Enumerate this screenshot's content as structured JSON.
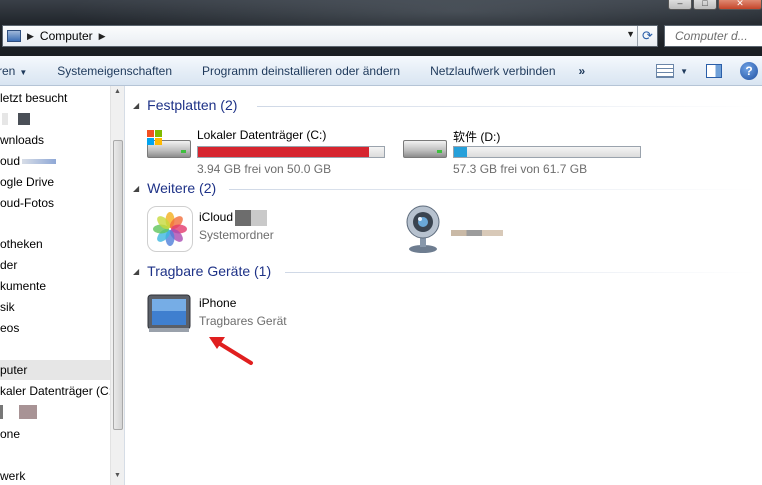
{
  "window": {
    "address_segment": "Computer",
    "search_placeholder": "Computer d...",
    "controls": [
      "minimize-icon",
      "maximize-icon",
      "close-icon"
    ]
  },
  "toolbar": {
    "organize_label": "ren",
    "items": [
      "Systemeigenschaften",
      "Programm deinstallieren oder ändern",
      "Netzlaufwerk verbinden"
    ],
    "more": "»"
  },
  "nav": {
    "items": [
      {
        "label": "letzt besucht"
      },
      {
        "label": ""
      },
      {
        "label": "wnloads"
      },
      {
        "label": "oud"
      },
      {
        "label": "ogle Drive"
      },
      {
        "label": "oud-Fotos"
      },
      {
        "label": "otheken"
      },
      {
        "label": "der"
      },
      {
        "label": "kumente"
      },
      {
        "label": "sik"
      },
      {
        "label": "eos"
      },
      {
        "label": "puter"
      },
      {
        "label": "kaler Datenträger (C:)"
      },
      {
        "label": ""
      },
      {
        "label": "one"
      },
      {
        "label": "werk"
      }
    ]
  },
  "content": {
    "groups": [
      {
        "title": "Festplatten (2)"
      },
      {
        "title": "Weitere (2)"
      },
      {
        "title": "Tragbare Geräte (1)"
      }
    ],
    "drive_c": {
      "name": "Lokaler Datenträger (C:)",
      "free_text": "3.94 GB frei von 50.0 GB",
      "used_fraction": 0.921,
      "bar_color": "#d6252f"
    },
    "drive_d": {
      "name": "软件 (D:)",
      "free_text": "57.3 GB frei von 61.7 GB",
      "used_fraction": 0.071,
      "bar_color": "#26a0da"
    },
    "icloud": {
      "name": "iCloud",
      "sub": "Systemordner"
    },
    "iphone": {
      "name": "iPhone",
      "sub": "Tragbares Gerät"
    }
  },
  "colors": {
    "accent_header": "#1e3287",
    "arrow": "#e01f1f"
  }
}
